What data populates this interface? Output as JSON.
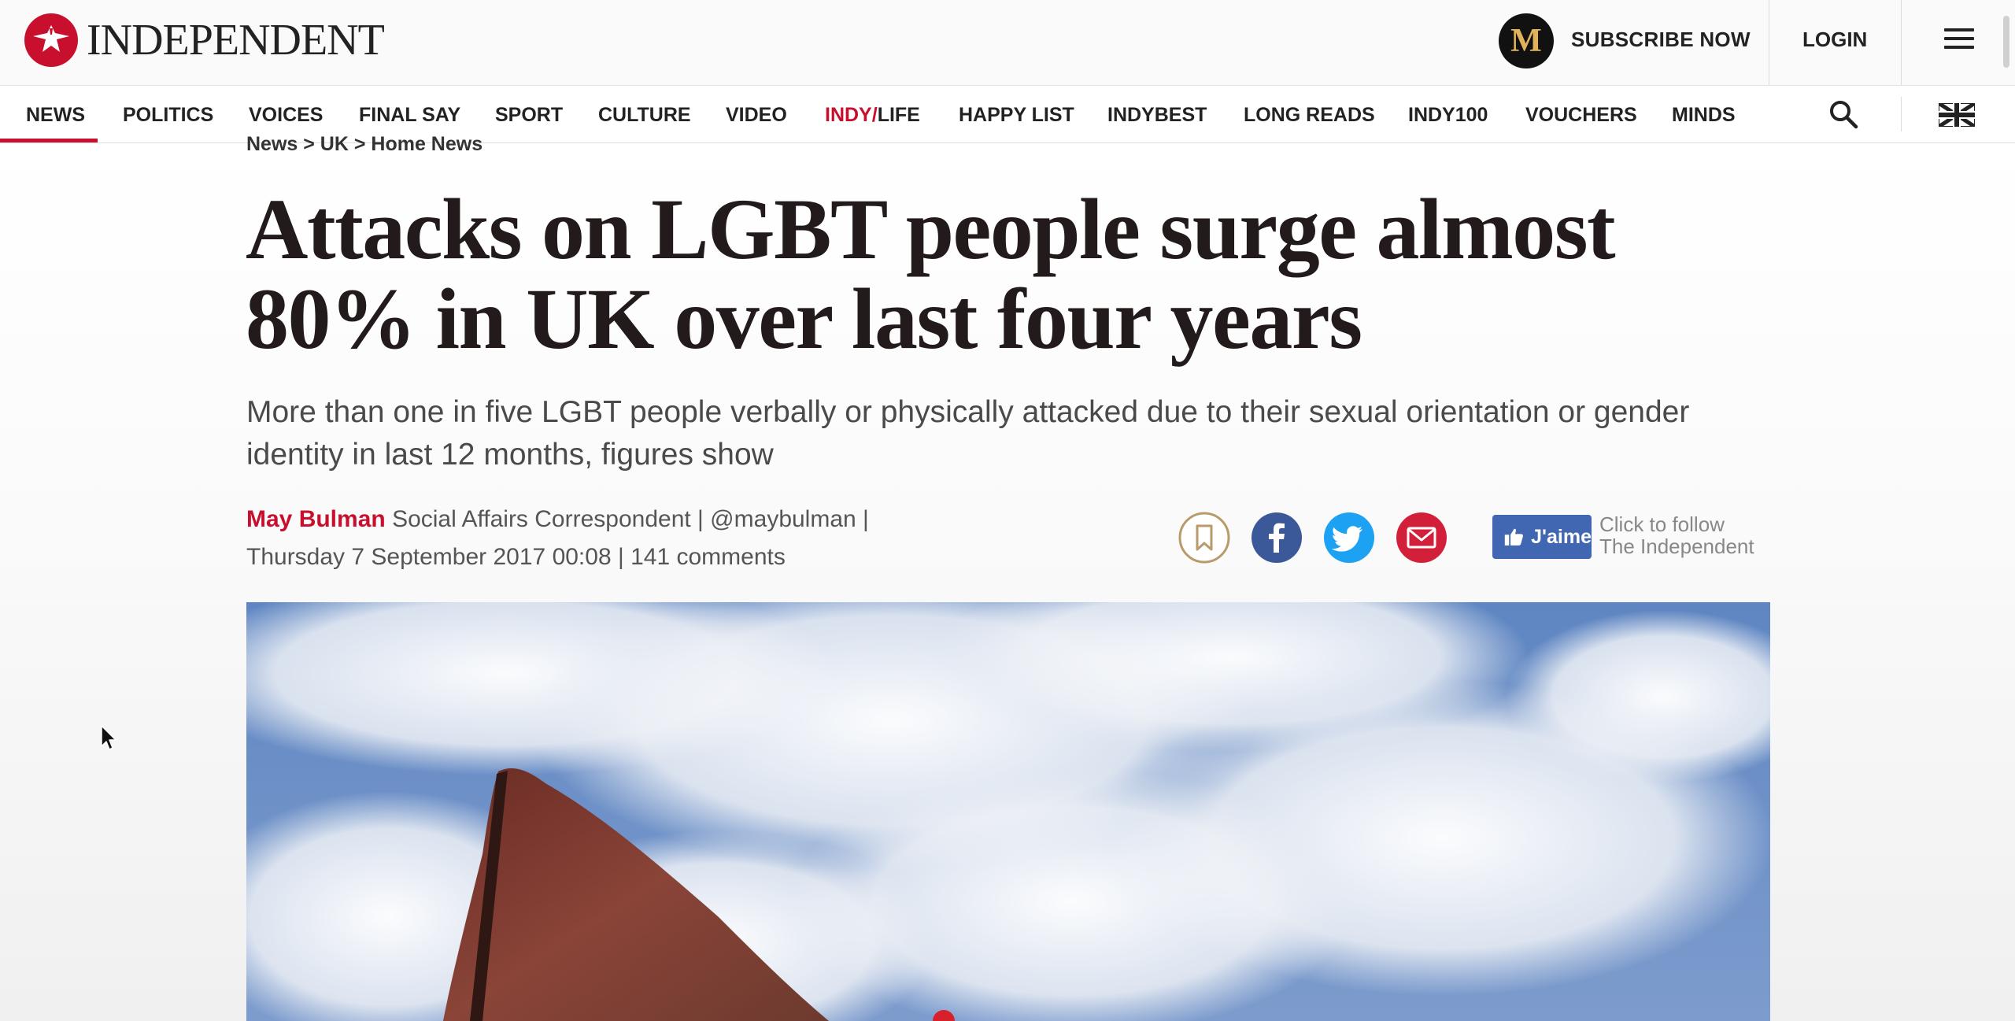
{
  "header": {
    "logo_text": "INDEPENDENT",
    "badge_letter": "M",
    "subscribe_label": "SUBSCRIBE NOW",
    "login_label": "LOGIN"
  },
  "nav": {
    "items": [
      "NEWS",
      "POLITICS",
      "VOICES",
      "FINAL SAY",
      "SPORT",
      "CULTURE",
      "VIDEO",
      "INDY/LIFE",
      "HAPPY LIST",
      "INDYBEST",
      "LONG READS",
      "INDY100",
      "VOUCHERS",
      "MINDS"
    ],
    "indy_life_a": "INDY/",
    "indy_life_b": "LIFE",
    "active": "NEWS"
  },
  "article": {
    "breadcrumb": "News > UK > Home News",
    "headline": "Attacks on LGBT people surge almost 80% in UK over last four years",
    "standfirst": "More than one in five LGBT people verbally or physically attacked due to their sexual orientation or gender identity in last 12 months, figures show",
    "author": "May Bulman",
    "author_role": "Social Affairs Correspondent | @maybulman |",
    "date": "Thursday 7 September 2017 00:08",
    "comments": "| 141 comments"
  },
  "social": {
    "fb_like_label": "J'aime",
    "follow_line1": "Click to follow",
    "follow_line2": "The Independent"
  },
  "colors": {
    "brand_red": "#c8102e",
    "facebook": "#3b5998",
    "twitter": "#1da1f2",
    "email": "#d3203a",
    "bookmark_gold": "#b89a6b"
  },
  "icons": [
    "eagle-logo-icon",
    "hamburger-menu-icon",
    "search-icon",
    "uk-flag-icon",
    "bookmark-icon",
    "facebook-icon",
    "twitter-icon",
    "email-icon",
    "thumbs-up-icon",
    "cursor-icon"
  ]
}
